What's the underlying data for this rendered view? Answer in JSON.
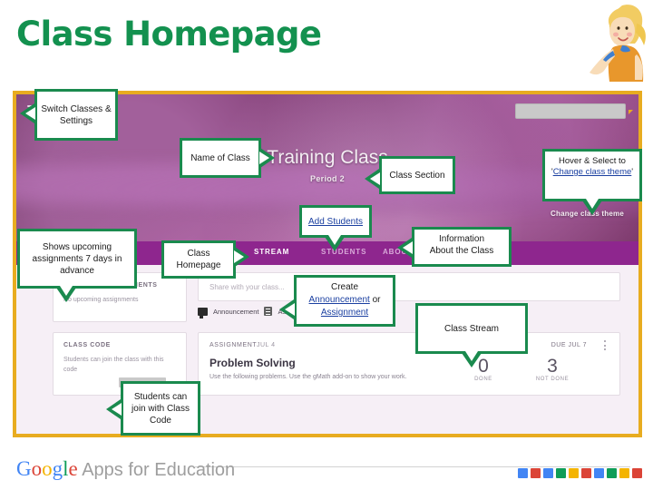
{
  "slide": {
    "title": "Class Homepage",
    "title_color": "#13914f"
  },
  "screenshot": {
    "frame_color": "#e8ac20",
    "banner": {
      "menu_icon": "hamburger-icon",
      "class_name": "Training Class",
      "class_section": "Period 2",
      "change_theme_label": "Change class theme",
      "search_value": ""
    },
    "nav_tabs": [
      {
        "label": "STREAM",
        "active": true
      },
      {
        "label": "STUDENTS",
        "active": false
      },
      {
        "label": "ABOUT",
        "active": false
      }
    ],
    "cards": {
      "upcoming": {
        "header": "UPCOMING ASSIGNMENTS",
        "body": "No upcoming assignments"
      },
      "class_code": {
        "header": "CLASS CODE",
        "body": "Students can join the class with this code"
      },
      "share": {
        "placeholder": "Share with your class...",
        "announcement_label": "Announcement",
        "assignment_label": "Assignment"
      },
      "assignment_post": {
        "kind": "ASSIGNMENT",
        "posted_date": "JUL 4",
        "due": "DUE JUL 7",
        "title": "Problem Solving",
        "description": "Use the following problems. Use the gMath add-on to show your work.",
        "done_count": "0",
        "done_label": "DONE",
        "not_done_count": "3",
        "not_done_label": "NOT DONE"
      }
    }
  },
  "callouts": {
    "switch_classes": "Switch Classes & Settings",
    "name_of_class": "Name of Class",
    "class_section": "Class Section",
    "change_theme_pre": "Hover & Select to '",
    "change_theme_link": "Change class theme",
    "change_theme_post": "'",
    "add_students": "Add Students",
    "upcoming_assignments": "Shows upcoming assignments 7 days in advance",
    "class_homepage": "Class Homepage",
    "information_pre": "Information",
    "information_link": "About the Class",
    "create_pre": "Create",
    "create_link1": "Announcement",
    "create_mid": " or ",
    "create_link2": "Assignment",
    "class_stream": "Class Stream",
    "class_code": "Students can join with Class Code"
  },
  "footer": {
    "logo_letters": [
      "G",
      "o",
      "o",
      "g",
      "l",
      "e"
    ],
    "logo_sub": " Apps for Education",
    "squares": [
      "#4285f4",
      "#db4437",
      "#4285f4",
      "#0f9d58",
      "#f4b400",
      "#db4437",
      "#4285f4",
      "#0f9d58",
      "#f4b400",
      "#db4437"
    ]
  }
}
